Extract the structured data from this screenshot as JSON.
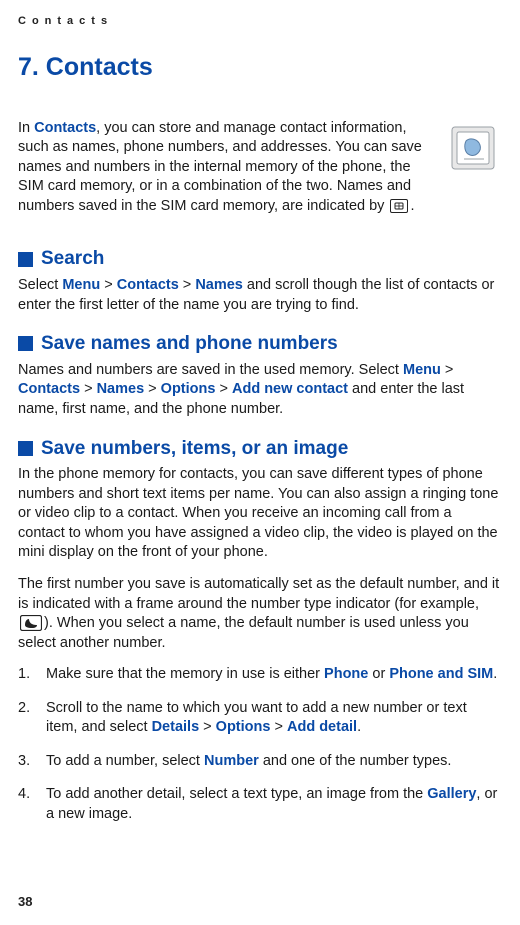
{
  "running_header": "Contacts",
  "chapter_title": "7. Contacts",
  "intro": {
    "pre": "In ",
    "link": "Contacts",
    "post": ", you can store and manage contact information, such as names, phone numbers, and addresses. You can save names and numbers in the internal memory of the phone, the SIM card memory, or in a combination of the two. Names and numbers saved in the SIM card memory, are indicated by",
    "tail": "."
  },
  "sections": {
    "search": {
      "title": "Search",
      "body_pre": "Select ",
      "menu": "Menu",
      "gt1": " > ",
      "contacts": "Contacts",
      "gt2": " > ",
      "names": "Names",
      "body_post": " and scroll though the list of contacts or enter the first letter of the name you are trying to find."
    },
    "save_names": {
      "title": "Save names and phone numbers",
      "body_pre": "Names and numbers are saved in the used memory. Select ",
      "menu": "Menu",
      "gt1": " > ",
      "contacts": "Contacts",
      "gt2": " > ",
      "names": "Names",
      "gt3": " > ",
      "options": "Options",
      "gt4": " > ",
      "add_new": "Add new contact",
      "body_post": " and enter the last name, first name, and the phone number."
    },
    "save_items": {
      "title": "Save numbers, items, or an image",
      "p1": "In the phone memory for contacts, you can save different types of phone numbers and short text items per name. You can also assign a ringing tone or video clip to a contact. When you receive an incoming call from a contact to whom you have assigned a video clip, the video is played on the mini display on the front of your phone.",
      "p2_pre": "The first number you save is automatically set as the default number, and it is indicated with a frame around the number type indicator (for example, ",
      "p2_post": "). When you select a name, the default number is used unless you select another number."
    }
  },
  "steps": {
    "s1_pre": "Make sure that the memory in use is either ",
    "s1_phone": "Phone",
    "s1_or": " or ",
    "s1_phone_sim": "Phone and SIM",
    "s1_post": ".",
    "s2_pre": "Scroll to the name to which you want to add a new number or text item, and select ",
    "s2_details": "Details",
    "s2_gt1": " > ",
    "s2_options": "Options",
    "s2_gt2": " > ",
    "s2_add_detail": "Add detail",
    "s2_post": ".",
    "s3_pre": "To add a number, select ",
    "s3_number": "Number",
    "s3_post": " and one of the number types.",
    "s4_pre": "To add another detail, select a text type, an image from the ",
    "s4_gallery": "Gallery",
    "s4_post": ", or a new image."
  },
  "page_number": "38"
}
